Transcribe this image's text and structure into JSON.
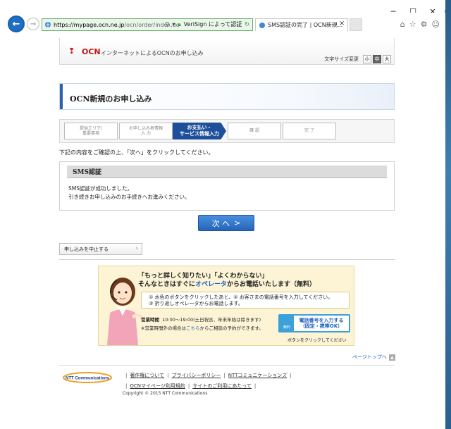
{
  "browser": {
    "address": {
      "url_host": "https://mypage.ocn.ne.jp",
      "url_path": "/ocn/order/index.do",
      "verisign": "VeriSign によって認証"
    },
    "tab": {
      "title": "SMS認証の完了 | OCN新規..."
    }
  },
  "header": {
    "logo_text": "OCN",
    "tagline": "インターネットによるOCNのお申し込み",
    "fontsize_label": "文字サイズ変更",
    "fontsize_options": [
      "小",
      "中",
      "大"
    ],
    "fontsize_selected": "中"
  },
  "page_title": "OCN新規のお申し込み",
  "steps": [
    {
      "label": "提供エリア/\n重要事項"
    },
    {
      "label": "お申し込み者情報\n入 力"
    },
    {
      "label": "お支払い・\nサービス情報入力"
    },
    {
      "label": "確 認"
    },
    {
      "label": "完 了"
    }
  ],
  "instruction": "下記の内容をご確認の上、「次へ」をクリックしてください。",
  "sms": {
    "heading": "SMS認証",
    "message1": "SMS認証が成功しました。",
    "message2": "引き続きお申し込みのお手続きへお進みください。"
  },
  "next_button": "次 へ",
  "cancel_button": "申し込みを中止する",
  "banner": {
    "line1": "「もっと詳しく知りたい」「よくわからない」",
    "line2_a": "そんなときはすぐに",
    "line2_op": "オペレータ",
    "line2_b": "からお電話いたします（無料）",
    "step1": "① 水色のボタンをクリックしたあと、② お客さまの電話番号を入力してください。",
    "step2": "③ 折り返しオペレータからお電話します。",
    "hours_label": "営業時間",
    "hours_value": "10:00～19:00(土日祝含、年末年始は除きます)",
    "hours_note_a": "※営業時間外の場合は",
    "hours_note_link": "こちら",
    "hours_note_b": "からご相談の予約ができます。",
    "call_free": "無料",
    "call_line1": "電話番号を入力する",
    "call_line2": "（固定・携帯OK）",
    "call_note": "ボタンをクリックしてください"
  },
  "pagetop": "ページトップへ",
  "footer": {
    "logo": "NTT Communications",
    "links_row1": [
      "著作権について",
      "プライバシーポリシー",
      "NTTコミュニケーションズ"
    ],
    "links_row2": [
      "OCNマイページ利用規約",
      "サイトのご利用にあたって"
    ],
    "copyright": "Copyright © 2015  NTT Communications"
  }
}
